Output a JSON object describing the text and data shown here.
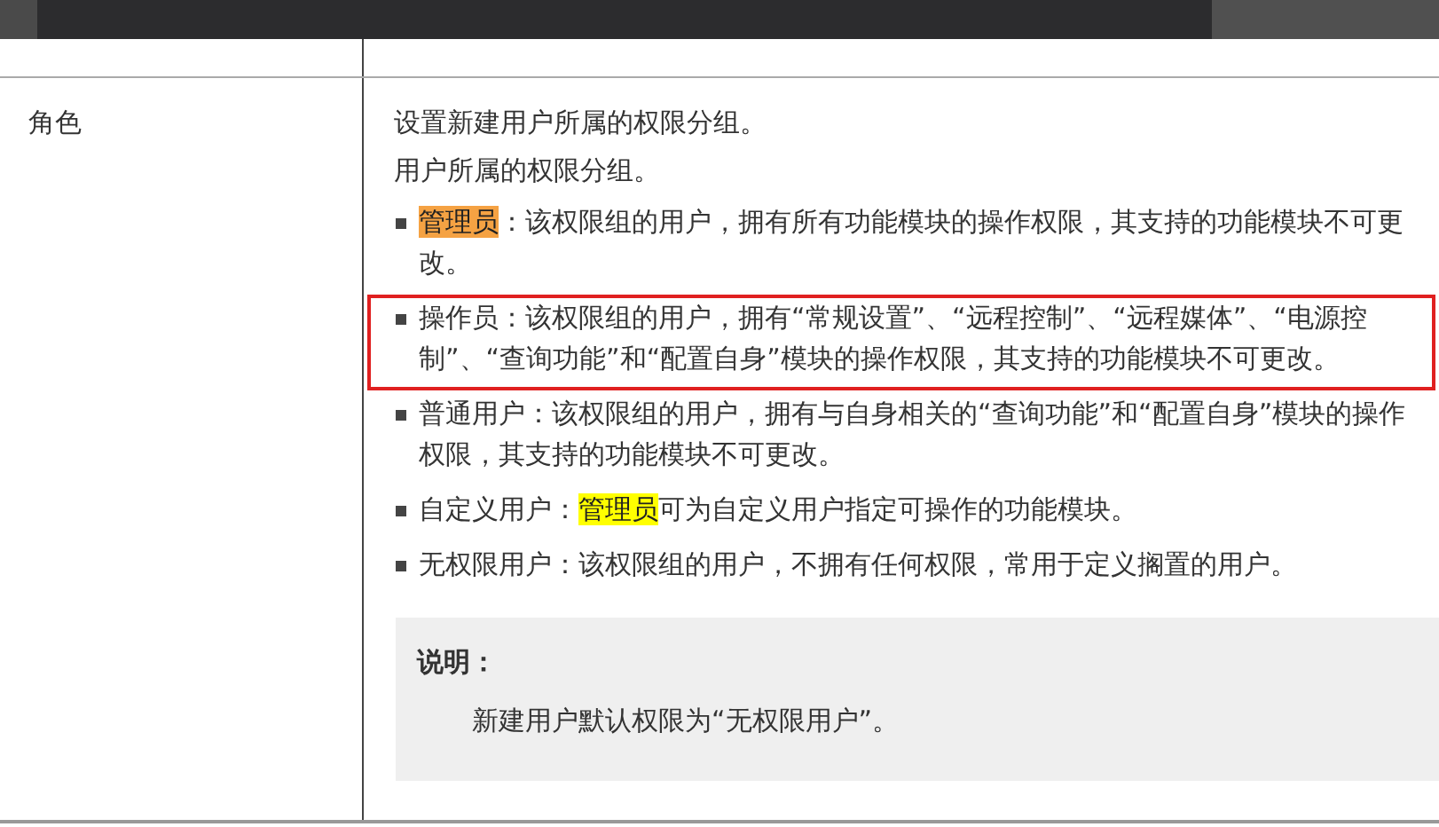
{
  "table": {
    "rows": [
      {
        "label": "角色",
        "paragraphs": [
          "设置新建用户所属的权限分组。",
          "用户所属的权限分组。"
        ],
        "items": [
          {
            "boxed": false,
            "parts": [
              {
                "text": "管理员",
                "color": "#f5a243"
              },
              {
                "text": "：该权限组的用户，拥有所有功能模块的操作权限，其支持的功能模块不可更改。"
              }
            ]
          },
          {
            "boxed": true,
            "parts": [
              {
                "text": "操作员：该权限组的用户，拥有“常规设置”、“远程控制”、“远程媒体”、“电源控制”、“查询功能”和“配置自身”模块的操作权限，其支持的功能模块不可更改。"
              }
            ]
          },
          {
            "boxed": false,
            "parts": [
              {
                "text": "普通用户：该权限组的用户，拥有与自身相关的“查询功能”和“配置自身”模块的操作权限，其支持的功能模块不可更改。"
              }
            ]
          },
          {
            "boxed": false,
            "parts": [
              {
                "text": "自定义用户："
              },
              {
                "text": "管理员",
                "color": "#ffff00"
              },
              {
                "text": "可为自定义用户指定可操作的功能模块。"
              }
            ]
          },
          {
            "boxed": false,
            "parts": [
              {
                "text": "无权限用户：该权限组的用户，不拥有任何权限，常用于定义搁置的用户。"
              }
            ]
          }
        ],
        "note": {
          "title": "说明：",
          "text": "新建用户默认权限为“无权限用户”。"
        }
      }
    ]
  }
}
